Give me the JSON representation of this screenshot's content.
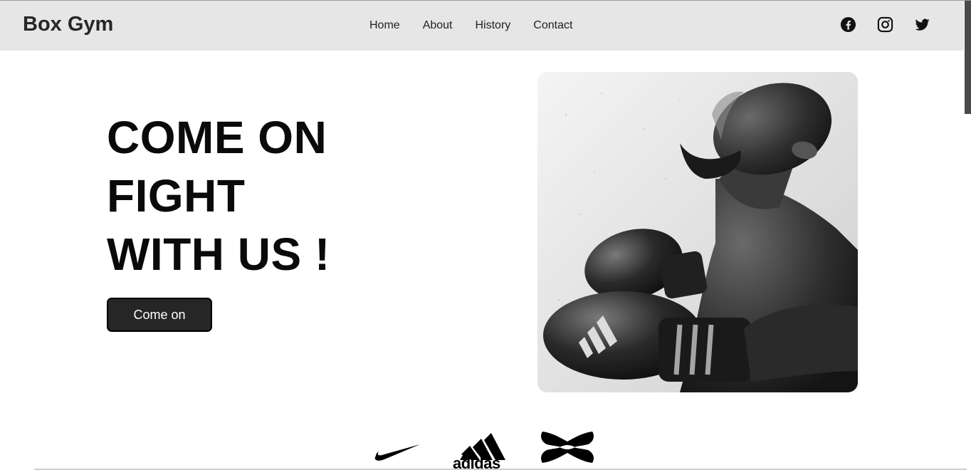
{
  "header": {
    "brand": "Box Gym",
    "nav": [
      "Home",
      "About",
      "History",
      "Contact"
    ],
    "social": [
      "facebook-icon",
      "instagram-icon",
      "twitter-icon"
    ]
  },
  "hero": {
    "title_lines": [
      "COME ON",
      "FIGHT",
      "WITH US !"
    ],
    "cta_label": "Come on",
    "image_alt": "boxer"
  },
  "sponsors": {
    "logos": [
      "nike-logo",
      "adidas-logo",
      "under-armour-logo"
    ],
    "adidas_text": "adidas"
  },
  "colors": {
    "navbar_bg": "#e6e6e6",
    "cta_bg": "#262626",
    "text": "#0a0a0a"
  }
}
